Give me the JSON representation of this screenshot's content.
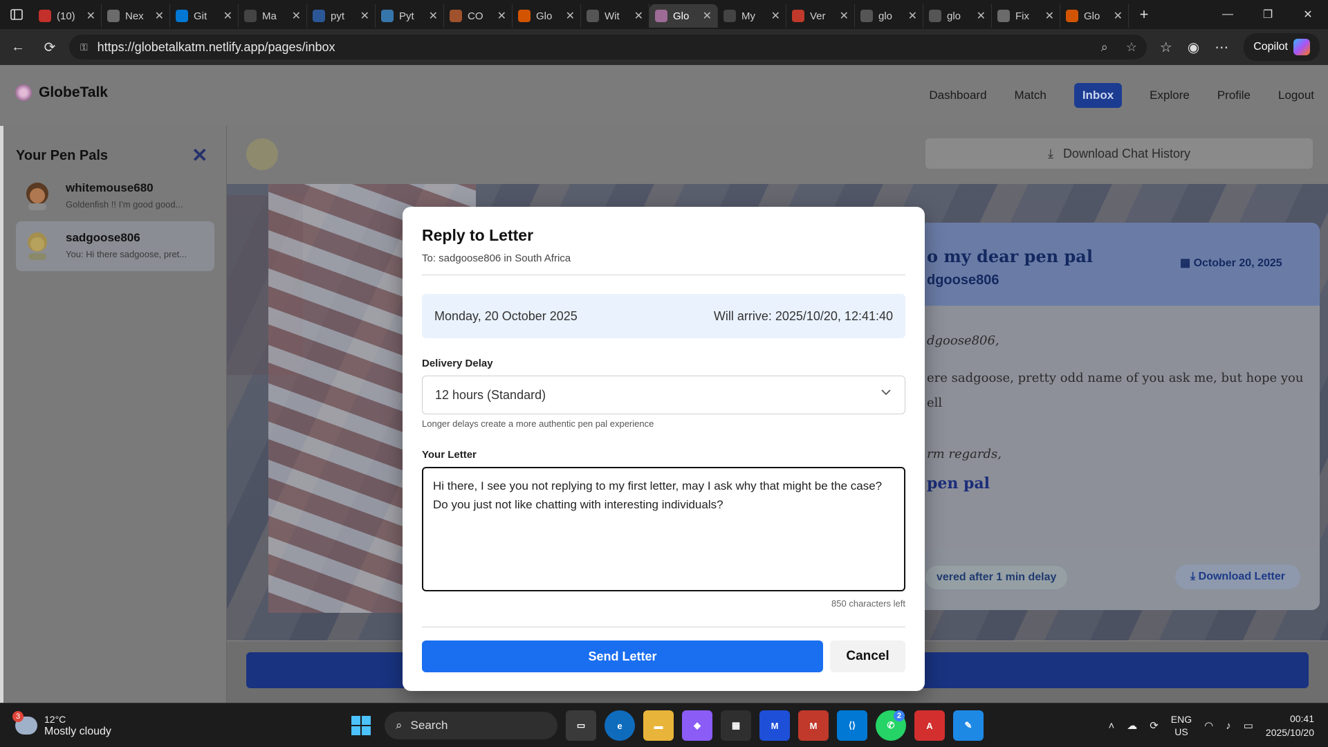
{
  "browser": {
    "tabs": [
      {
        "label": "(10)",
        "color": "#c4302b"
      },
      {
        "label": "Nex",
        "color": "#6b6b6b"
      },
      {
        "label": "Git",
        "color": "#0078d4"
      },
      {
        "label": "Ma",
        "color": "#444444"
      },
      {
        "label": "pyt",
        "color": "#2b5797"
      },
      {
        "label": "Pyt",
        "color": "#3776ab"
      },
      {
        "label": "CO",
        "color": "#a0522d"
      },
      {
        "label": "Glo",
        "color": "#d35400"
      },
      {
        "label": "Wit",
        "color": "#555555"
      },
      {
        "label": "Glo",
        "color": "#9d6b95"
      },
      {
        "label": "My",
        "color": "#444444"
      },
      {
        "label": "Ver",
        "color": "#c0392b"
      },
      {
        "label": "glo",
        "color": "#555555"
      },
      {
        "label": "glo",
        "color": "#555555"
      },
      {
        "label": "Fix",
        "color": "#6b6b6b"
      },
      {
        "label": "Glo",
        "color": "#d35400"
      }
    ],
    "url": "https://globetalkatm.netlify.app/pages/inbox",
    "copilot_label": "Copilot"
  },
  "app": {
    "name": "GlobeTalk",
    "nav": [
      "Dashboard",
      "Match",
      "Inbox",
      "Explore",
      "Profile",
      "Logout"
    ],
    "active_nav": "Inbox"
  },
  "sidebar": {
    "title": "Your Pen Pals",
    "pals": [
      {
        "name": "whitemouse680",
        "preview": "Goldenfish !! I'm good good..."
      },
      {
        "name": "sadgoose806",
        "preview": "You: Hi there sadgoose, pret..."
      }
    ]
  },
  "conversation": {
    "download_chat": "Download Chat History",
    "letter": {
      "heading": "o my dear pen pal",
      "from": "dgoose806",
      "date": "October 20, 2025",
      "salutation": "dgoose806,",
      "body_line1": "ere sadgoose, pretty odd name of you ask me, but hope you",
      "body_line2": "ell",
      "closing": "rm regards,",
      "signature": "pen pal",
      "delivered": "vered after 1 min delay",
      "download_letter": "Download Letter"
    },
    "reply_button": "Reply to Letter"
  },
  "modal": {
    "title": "Reply to Letter",
    "to": "To: sadgoose806 in South Africa",
    "date": "Monday, 20 October 2025",
    "arrival": "Will arrive: 2025/10/20, 12:41:40",
    "delay_label": "Delivery Delay",
    "delay_value": "12 hours (Standard)",
    "delay_hint": "Longer delays create a more authentic pen pal experience",
    "letter_label": "Your Letter",
    "letter_text": "Hi there, I see you not replying to my first letter, may I ask why that might be the case? Do you just not like chatting with interesting individuals?",
    "chars_left": "850 characters left",
    "send": "Send Letter",
    "cancel": "Cancel"
  },
  "taskbar": {
    "weather_badge": "3",
    "temp": "12°C",
    "condition": "Mostly cloudy",
    "search": "Search",
    "whatsapp_badge": "2",
    "lang1": "ENG",
    "lang2": "US",
    "time": "00:41",
    "date": "2025/10/20"
  }
}
